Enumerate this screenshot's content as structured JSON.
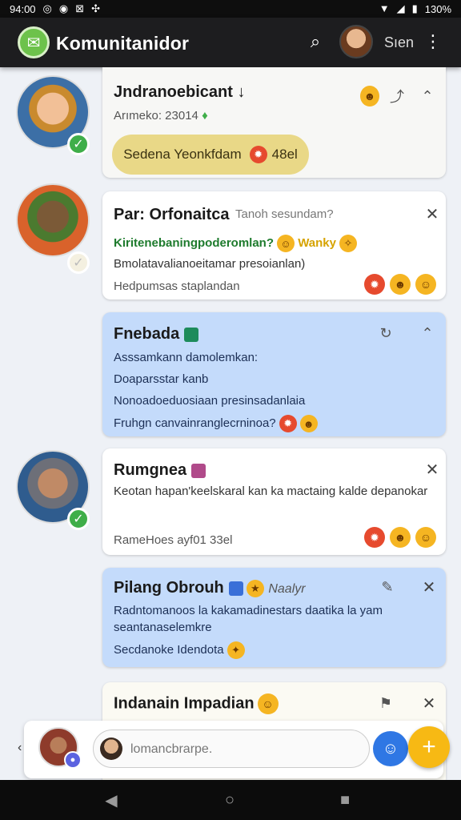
{
  "status_bar": {
    "time": "94:00",
    "battery": "130%",
    "icons_left": [
      "instagram-icon",
      "record-icon",
      "x-icon",
      "fan-icon"
    ],
    "icons_right": [
      "wifi-icon",
      "signal-icon",
      "battery-icon"
    ]
  },
  "app_bar": {
    "title": "Komunitanidor",
    "user_label": "Sıen",
    "logo_icon": "chat-leaf-icon",
    "accent": "#6dc24b"
  },
  "posts": [
    {
      "title": "Jndranoebicant",
      "subtitle": "Arımeko: 23014",
      "pill_text": "Sedena Yeonkfdam",
      "pill_count": "48el",
      "pill_color": "#e9d887"
    },
    {
      "title": "Par: Orfonaitca",
      "title_hint": "Tanoh sesundam?",
      "line1": "Kiritenebaningpoderomlan?",
      "line1_tag": "Wanky",
      "line2": "Bmolatavalianoeitamar presoianlan)",
      "line3": "Hedpumsas staplandan"
    },
    {
      "title": "Fnebada",
      "line1": "Asssamkann damolemkan:",
      "line2": "Doaparsstar kanb",
      "line3": "Nonoadoeduosiaan presinsadanlaia",
      "line4": "Fruhgn canvainranglecrninoa?",
      "bg_color": "#c4dbfb"
    },
    {
      "title": "Rumgnea",
      "body": "Keotan hapan'keelskaral kan ka mactaing kalde depanokar",
      "footer": "RameHoes ayf01 33el"
    },
    {
      "title": "Pilang Obrouh",
      "title_tag": "Naalyr",
      "body": "Radntomanoos la kakamadinestars daatika la yam seantanaselemkre",
      "footer": "Secdanoke Idendota",
      "bg_color": "#c4dbfb"
    },
    {
      "title": "Indanain Impadian"
    }
  ],
  "composer": {
    "placeholder": "lomancbrarpe."
  },
  "nav_bar": {
    "back_icon": "back-triangle-icon",
    "home_icon": "home-circle-icon",
    "recents_icon": "recents-square-icon"
  }
}
